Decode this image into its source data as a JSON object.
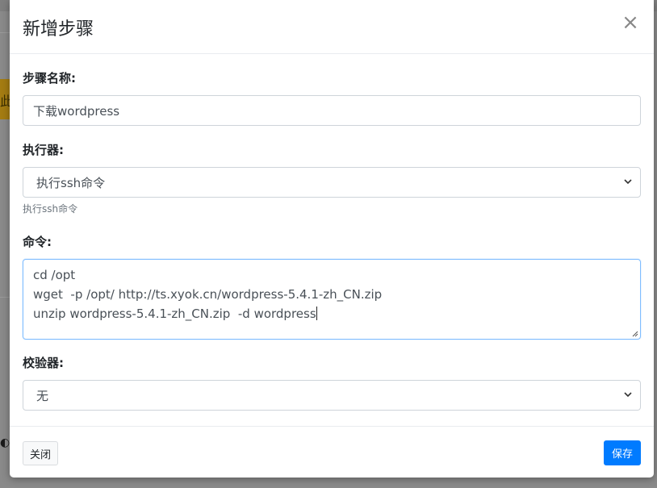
{
  "background": {
    "alert_fragment": "此"
  },
  "modal": {
    "title": "新增步骤",
    "close_glyph": "×"
  },
  "form": {
    "step_name": {
      "label": "步骤名称:",
      "value": "下载wordpress"
    },
    "executor": {
      "label": "执行器:",
      "selected": "执行ssh命令",
      "help": "执行ssh命令"
    },
    "command": {
      "label": "命令:",
      "lines": [
        "cd /opt",
        "wget  -p /opt/ http://ts.xyok.cn/wordpress-5.4.1-zh_CN.zip",
        "unzip wordpress-5.4.1-zh_CN.zip  -d wordpress"
      ]
    },
    "validator": {
      "label": "校验器:",
      "selected": "无"
    }
  },
  "footer": {
    "close_label": "关闭",
    "save_label": "保存"
  },
  "colors": {
    "primary": "#007bff",
    "focus_border": "#80bdff",
    "overlay": "#8a8a8a"
  },
  "icons": {
    "select_arrow": "chevron-down-icon",
    "close": "close-icon",
    "resize": "resize-handle-icon"
  }
}
